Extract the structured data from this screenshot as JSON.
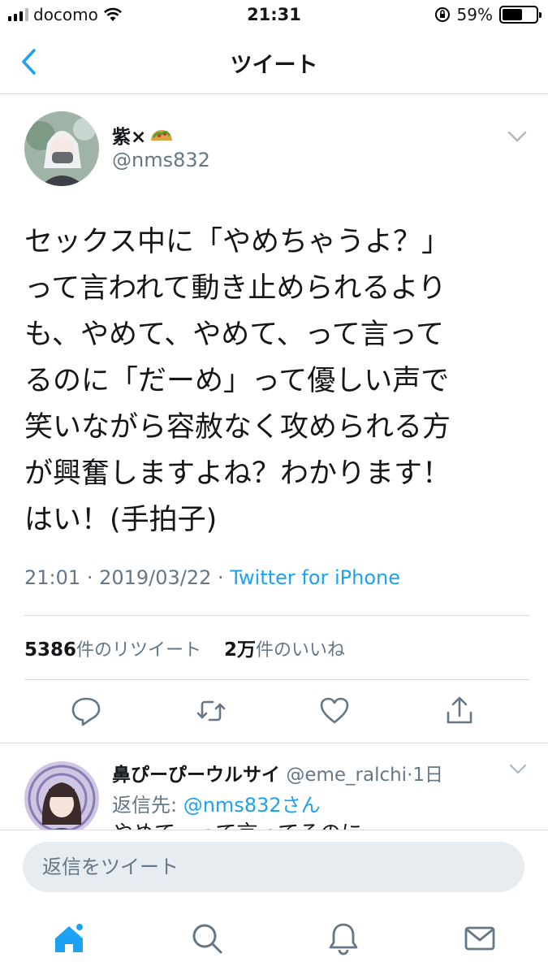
{
  "status_bar": {
    "carrier": "docomo",
    "time": "21:31",
    "battery_percent": "59%",
    "battery_level": 0.59
  },
  "nav": {
    "title": "ツイート",
    "back_icon": "chevron-left-icon"
  },
  "tweet": {
    "display_name": "紫×",
    "username": "@nms832",
    "text": "セックス中に「やめちゃうよ？」\nって言われて動き止められるより\nも、やめて、やめて、って言って\nるのに「だーめ」って優しい声で\n笑いながら容赦なく攻められる方\nが興奮しますよね？わかります！\nはい！(手拍子)",
    "time": "21:01",
    "date": "2019/03/22",
    "source": "Twitter for iPhone",
    "retweet_count": "5386",
    "retweet_label": "件のリツイート",
    "like_count": "2万",
    "like_label": "件のいいね"
  },
  "actions": [
    "reply-icon",
    "retweet-icon",
    "like-icon",
    "share-icon"
  ],
  "reply": {
    "display_name": "鼻ぴーぴーウルサイ",
    "handle": "@eme_ralchi",
    "age": "1日",
    "reply_to_label": "返信先: ",
    "reply_to_mention": "@nms832さん",
    "preview_text": "やめて、って言ってるのに"
  },
  "composer": {
    "placeholder": "返信をツイート"
  },
  "tab_bar": [
    "home-icon",
    "search-icon",
    "notifications-icon",
    "messages-icon"
  ],
  "colors": {
    "accent": "#1da1f2",
    "secondary_text": "#657786"
  }
}
